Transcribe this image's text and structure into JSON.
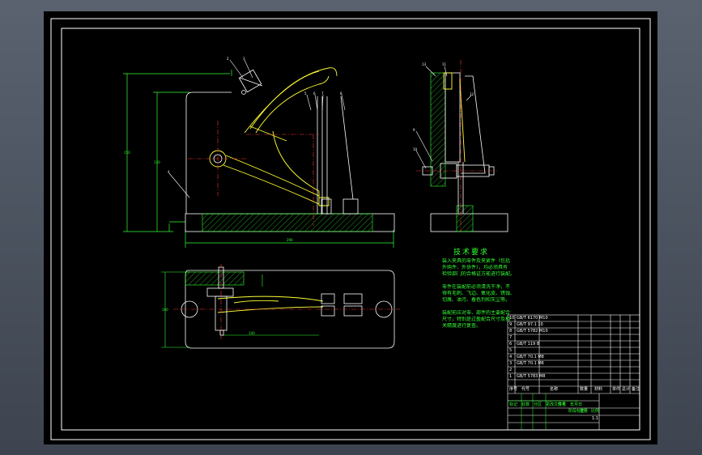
{
  "colors": {
    "background": "#000000",
    "frame": "#ffffff",
    "dimension": "#33ff33",
    "part": "#ffff33",
    "hatch": "#33ff33",
    "centerline": "#ff3333",
    "bolt": "#ffffff",
    "leader": "#ffffff"
  },
  "balloons": {
    "front_view": [
      "2",
      "3",
      "4",
      "5",
      "6",
      "7",
      "8"
    ],
    "side_view": [
      "9",
      "10",
      "11",
      "12",
      "13"
    ]
  },
  "tech_requirements": {
    "title": "技术要求",
    "lines": [
      "装入夹具的零件及夹紧件（包括",
      "外购件、外协件），均必须具有",
      "检验部门的合格证方能进行装配。",
      "零件在装配前必须清洗干净，不",
      "得有毛刺、飞边、氧化皮、锈蚀、",
      "切屑、油污、着色剂和灰尘等。",
      "装配前应对零、部件的主要配合",
      "尺寸，特别是过盈配合尺寸及相",
      "关精度进行复查。"
    ]
  },
  "title_block": {
    "rows": [
      "GB/T 6170 M10",
      "GB/T 97.1 10",
      "GB/T 5782 M10",
      "",
      "GB/T 119 8",
      "",
      "GB/T 70.1 M8",
      "GB/T 70.1 M6",
      "",
      "GB/T 5783 M8"
    ],
    "header": [
      "序号",
      "代号",
      "名称",
      "数量",
      "材料",
      "单件",
      "总计",
      "备注"
    ],
    "footer_left": [
      "标记",
      "处数",
      "分区",
      "更改文件号",
      "签名",
      "年月日"
    ],
    "footer_mid": [
      "阶段标记",
      "重量",
      "比例"
    ],
    "scale": "1:1"
  }
}
